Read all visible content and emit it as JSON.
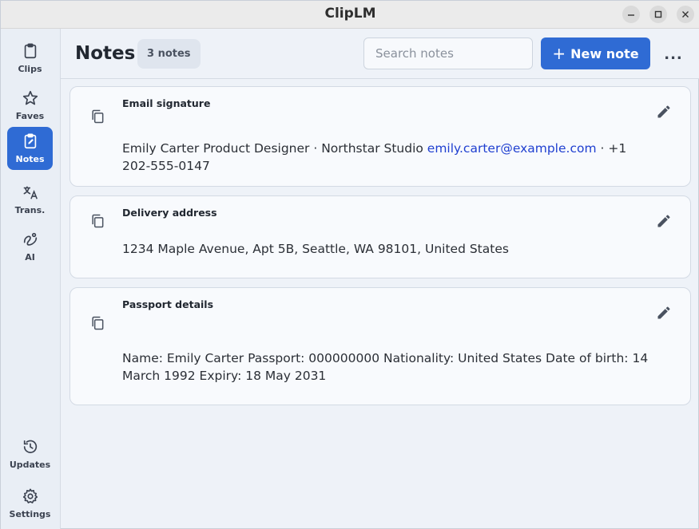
{
  "window": {
    "title": "ClipLM"
  },
  "sidebar": {
    "items": [
      {
        "label": "Clips",
        "icon": "clipboard-icon"
      },
      {
        "label": "Faves",
        "icon": "star-icon"
      },
      {
        "label": "Notes",
        "icon": "note-edit-icon",
        "active": true
      },
      {
        "label": "Trans.",
        "icon": "translate-icon"
      },
      {
        "label": "AI",
        "icon": "ai-squiggle-icon"
      }
    ],
    "bottom_items": [
      {
        "label": "Updates",
        "icon": "history-icon"
      },
      {
        "label": "Settings",
        "icon": "gear-icon"
      }
    ]
  },
  "header": {
    "title": "Notes",
    "count": "3 notes",
    "search_placeholder": "Search notes",
    "new_button": "New note",
    "more": "..."
  },
  "notes": [
    {
      "title": "Email signature",
      "body_pre": "Emily Carter Product Designer · Northstar Studio ",
      "body_link": "emily.carter@example.com",
      "body_post": " · +1 202-555-0147"
    },
    {
      "title": "Delivery address",
      "body": "1234 Maple Avenue, Apt 5B, Seattle, WA 98101, United States"
    },
    {
      "title": "Passport details",
      "body": "Name: Emily Carter Passport: 000000000 Nationality: United States Date of birth: 14 March 1992 Expiry: 18 May 2031"
    }
  ],
  "colors": {
    "accent": "#2f6bd4",
    "link": "#1f3fd0",
    "background": "#eef2f8"
  }
}
